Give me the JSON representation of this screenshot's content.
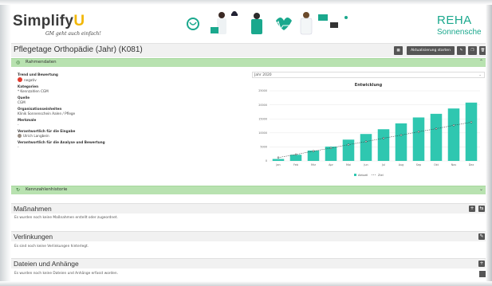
{
  "header": {
    "logo_text": "Simplify",
    "logo_accent": "U",
    "tagline": "GM geht auch einfach!",
    "brand_top": "REHA",
    "brand_bottom": "Sonnensche",
    "brand_color": "#1aa88d"
  },
  "page": {
    "title": "Pflegetage Orthopädie (Jahr) (K081)",
    "toolbar": {
      "grid_icon": "grid-icon",
      "refresh_label": "Aktualisierung starten",
      "edit_icon": "edit-icon",
      "copy_icon": "copy-icon",
      "delete_icon": "trash-icon"
    }
  },
  "rahmendaten": {
    "title": "Rahmendaten",
    "fields": [
      {
        "label": "Trend und Bewertung",
        "value": "negativ"
      },
      {
        "label": "Kategorien",
        "value": "* Kennzahlen CGM"
      },
      {
        "label": "Quelle",
        "value": "CGM"
      },
      {
        "label": "Organisationseinheiten",
        "value": "Klinik Sonnenschein Aalen / Pflege"
      },
      {
        "label": "Merkmale",
        "value": "-"
      },
      {
        "label": "Verantwortlich für die Eingabe",
        "value": "Ulrich Langbein"
      },
      {
        "label": "Verantwortlich für die Analyse und Bewertung",
        "value": "-"
      }
    ],
    "select_value": "Jahr 2020"
  },
  "chart_data": {
    "type": "bar",
    "title": "Entwicklung",
    "categories": [
      "Jan",
      "Feb",
      "Mrz",
      "Apr",
      "Mai",
      "Jun",
      "Jul",
      "Aug",
      "Sep",
      "Okt",
      "Nov",
      "Dez"
    ],
    "series": [
      {
        "name": "Aktuell",
        "type": "bar",
        "color": "#2fc7b0",
        "values": [
          700,
          2200,
          3700,
          5100,
          7600,
          9600,
          11300,
          13400,
          15500,
          16800,
          18700,
          20800
        ]
      },
      {
        "name": "Ziel",
        "type": "line",
        "color": "#333333",
        "values": [
          1200,
          2300,
          3500,
          4600,
          5800,
          6900,
          8100,
          9200,
          10400,
          11500,
          12700,
          13800
        ]
      }
    ],
    "ylim": [
      0,
      25000
    ],
    "yticks": [
      "0",
      "5000",
      "10000",
      "15000",
      "20000",
      "25000"
    ],
    "legend_position": "bottom-center",
    "grid": true
  },
  "kennzahlenhistorie": {
    "title": "Kennzahlenhistorie"
  },
  "massnahmen": {
    "title": "Maßnahmen",
    "note": "Es wurden noch keine Maßnahmen erstellt oder zugeordnet."
  },
  "verlinkungen": {
    "title": "Verlinkungen",
    "note": "Es sind noch keine Verlinkungen hinterlegt."
  },
  "dateien": {
    "title": "Dateien und Anhänge",
    "note": "Es wurden noch keine Dateien und Anhänge erfasst worden."
  }
}
